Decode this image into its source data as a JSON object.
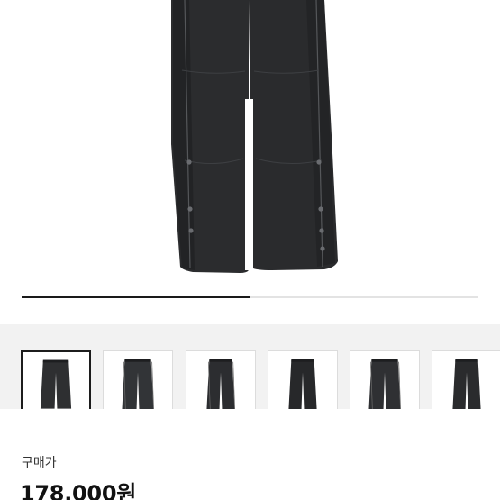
{
  "gallery": {
    "image_count": 6,
    "selected_index": 0,
    "progress_fraction": 0.5
  },
  "thumbnails": [
    {
      "alt": "pants-front-view"
    },
    {
      "alt": "pants-side-stripe-view"
    },
    {
      "alt": "pants-back-view"
    },
    {
      "alt": "pants-flat-front"
    },
    {
      "alt": "pants-flat-side"
    },
    {
      "alt": "pants-flat-back"
    }
  ],
  "price": {
    "label": "구매가",
    "value": "178,000원"
  },
  "colors": {
    "garment": "#2b2c2e",
    "garment_shadow": "#1e1f21",
    "strip_bg": "#f2f2f2",
    "progress": "#1a1a1a"
  }
}
